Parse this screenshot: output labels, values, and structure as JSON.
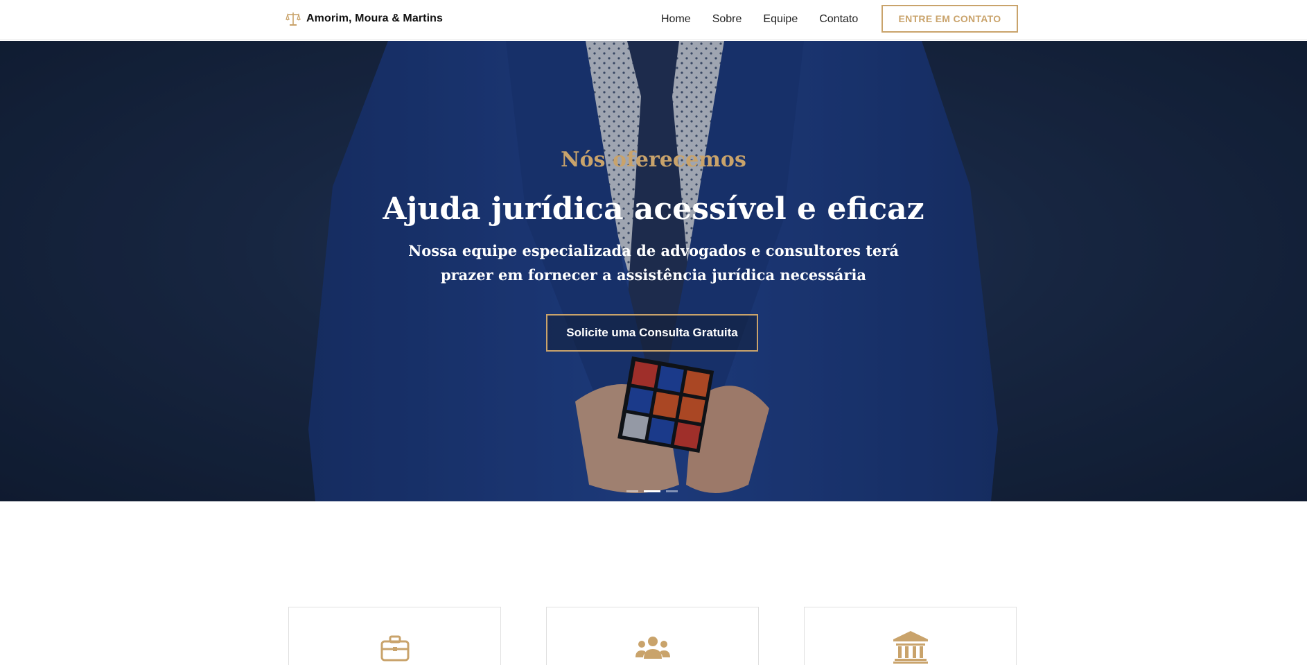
{
  "header": {
    "brand_name": "Amorim, Moura & Martins",
    "logo_icon": "scales-of-justice-icon",
    "nav": [
      "Home",
      "Sobre",
      "Equipe",
      "Contato"
    ],
    "cta_label": "ENTRE EM CONTATO"
  },
  "hero": {
    "kicker": "Nós oferecemos",
    "headline": "Ajuda jurídica acessível e eficaz",
    "subtext": "Nossa equipe especializada de advogados e consultores terá prazer em fornecer a assistência jurídica necessária",
    "button_label": "Solicite uma Consulta Gratuita",
    "slides": 3,
    "active_slide": 2
  },
  "cards": [
    {
      "icon": "briefcase-icon"
    },
    {
      "icon": "users-group-icon"
    },
    {
      "icon": "bank-building-icon"
    }
  ],
  "colors": {
    "accent": "#c9a36b",
    "hero_bg": "#1c2c4a",
    "suit": "#1f3f86"
  }
}
